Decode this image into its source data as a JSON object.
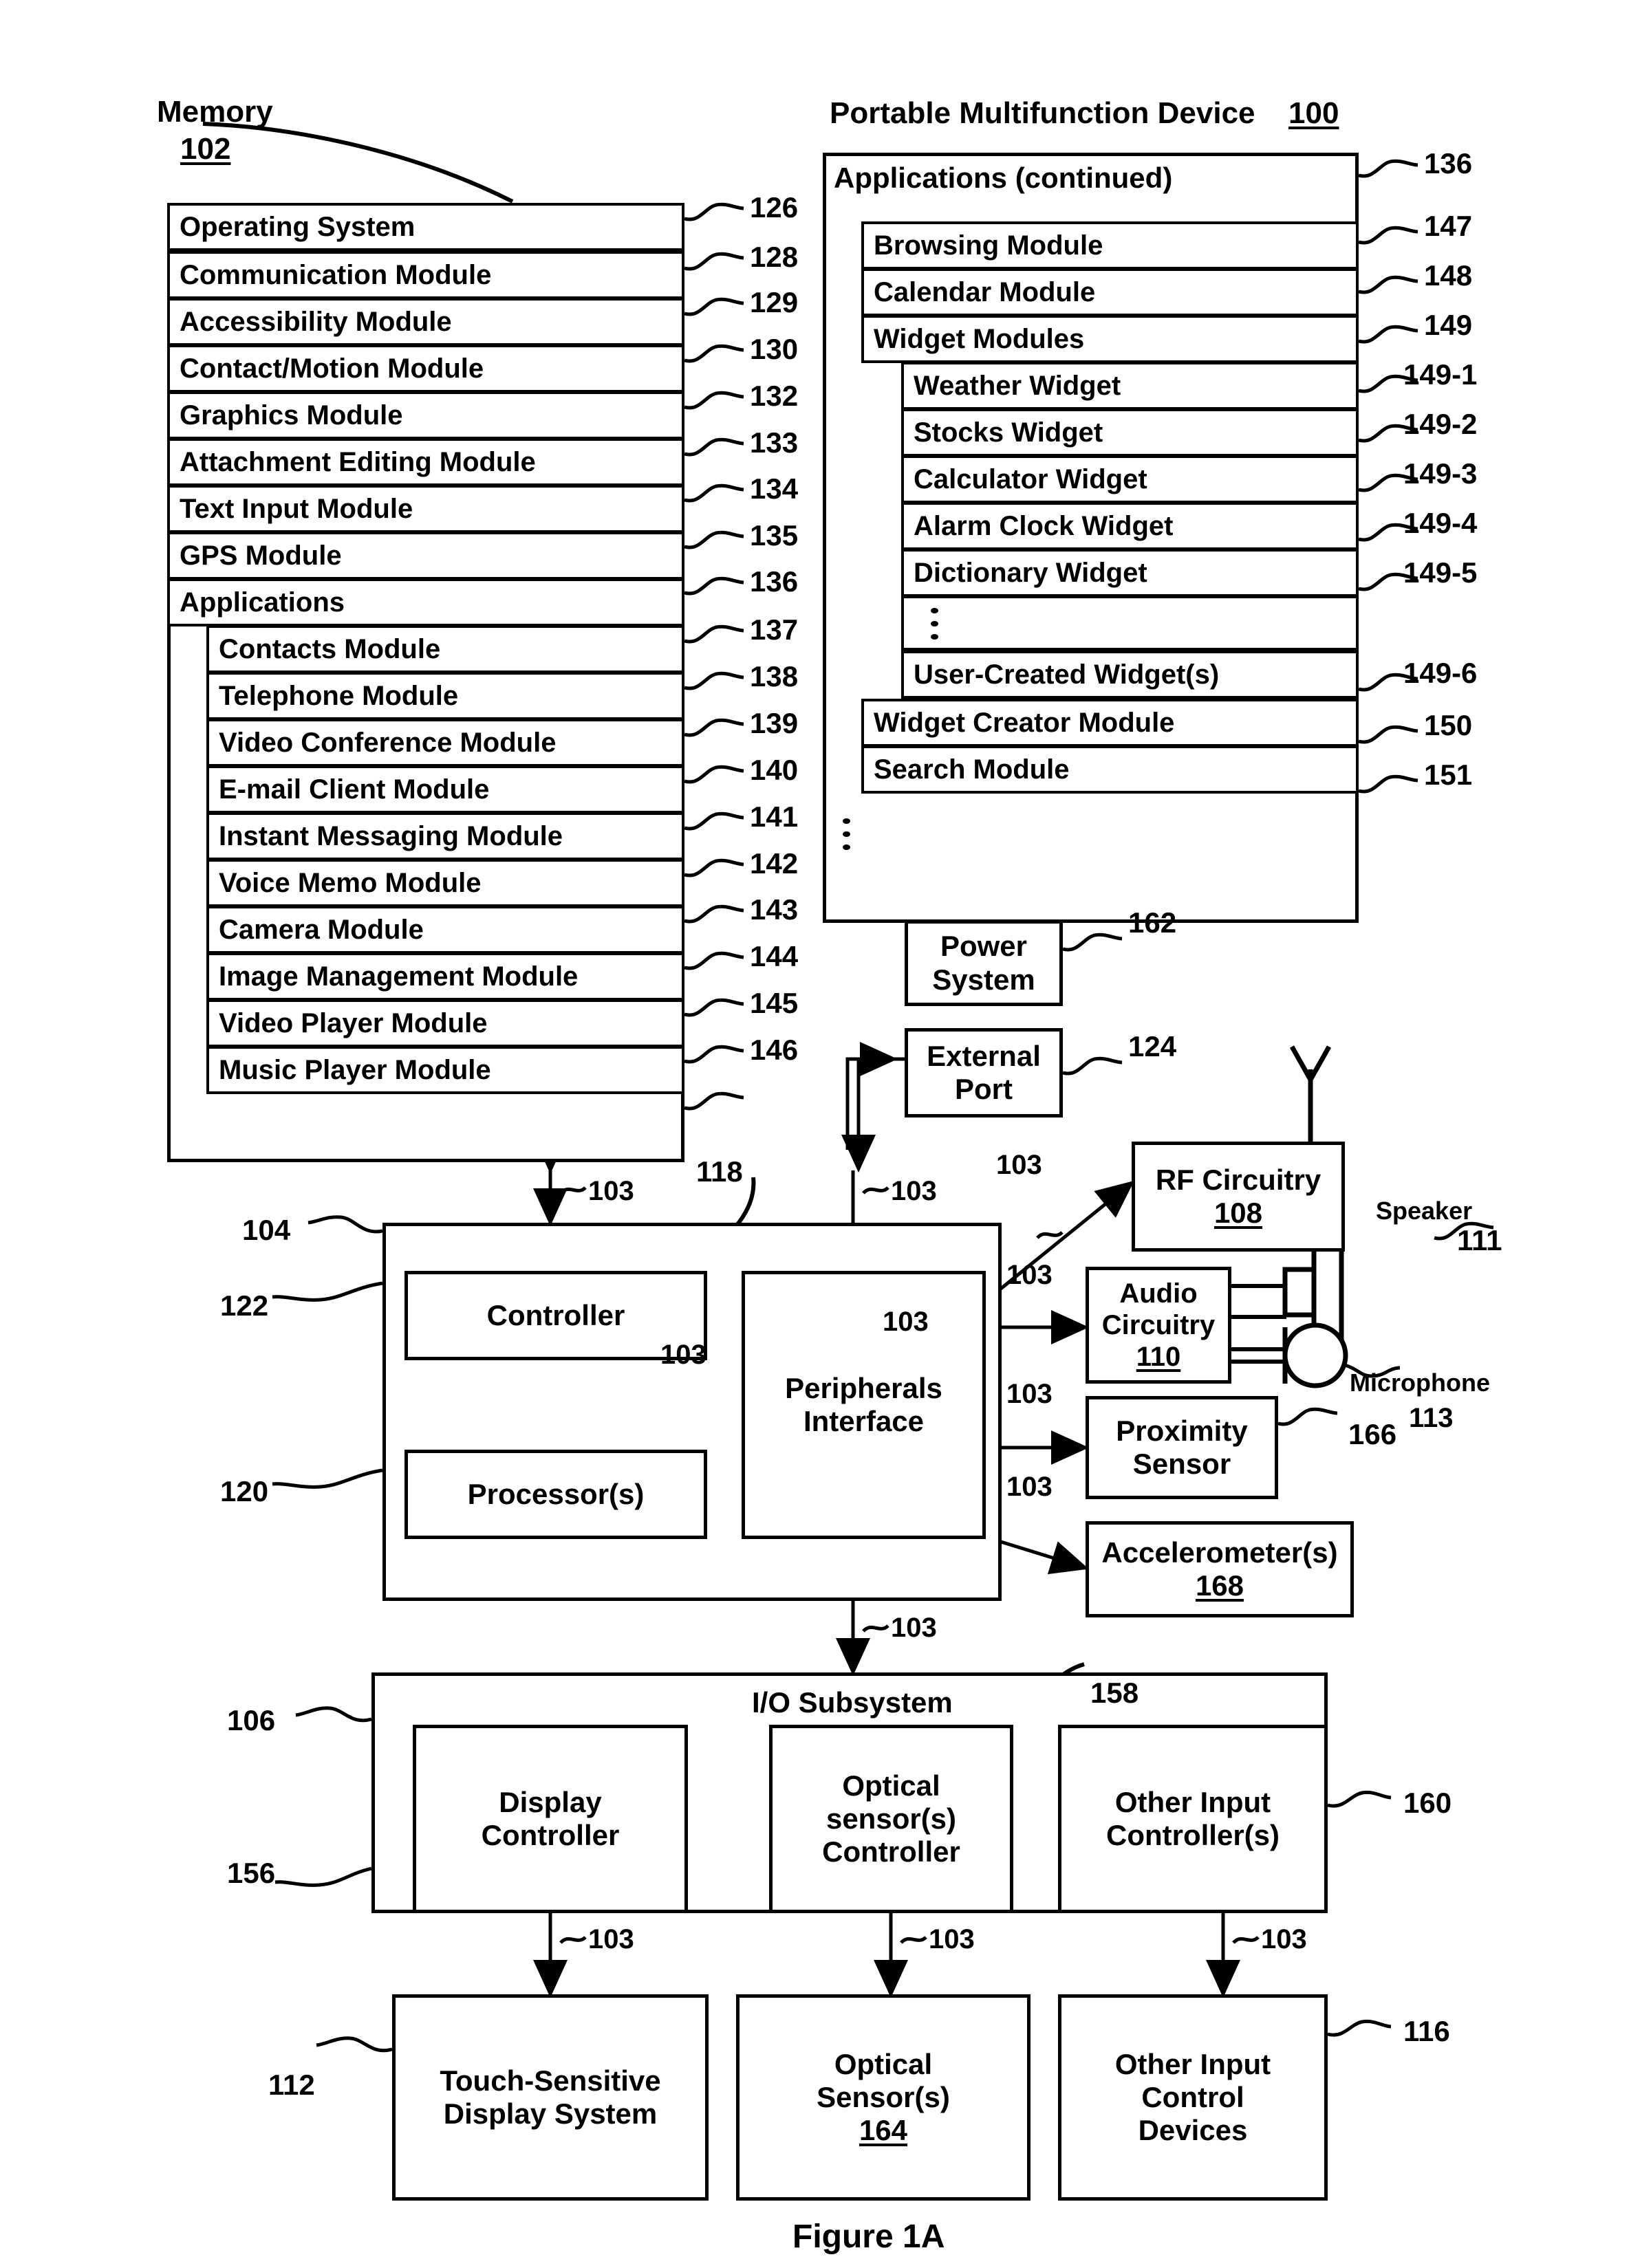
{
  "figure": {
    "caption": "Figure 1A"
  },
  "memory": {
    "title": "Memory",
    "ref": "102",
    "rows": [
      {
        "label": "Operating System",
        "ref": "126"
      },
      {
        "label": "Communication Module",
        "ref": "128"
      },
      {
        "label": "Accessibility Module",
        "ref": "129"
      },
      {
        "label": "Contact/Motion Module",
        "ref": "130"
      },
      {
        "label": "Graphics Module",
        "ref": "132"
      },
      {
        "label": "Attachment Editing Module",
        "ref": "133"
      },
      {
        "label": "Text Input Module",
        "ref": "134"
      },
      {
        "label": "GPS Module",
        "ref": "135"
      },
      {
        "label": "Applications",
        "ref": "136"
      }
    ],
    "applications": [
      {
        "label": "Contacts Module",
        "ref": "137"
      },
      {
        "label": "Telephone Module",
        "ref": "138"
      },
      {
        "label": "Video Conference Module",
        "ref": "139"
      },
      {
        "label": "E-mail Client Module",
        "ref": "140"
      },
      {
        "label": "Instant Messaging Module",
        "ref": "141"
      },
      {
        "label": "Voice Memo Module",
        "ref": "142"
      },
      {
        "label": "Camera Module",
        "ref": "143"
      },
      {
        "label": "Image Management Module",
        "ref": "144"
      },
      {
        "label": "Video Player Module",
        "ref": "145"
      },
      {
        "label": "Music Player Module",
        "ref": "146"
      }
    ]
  },
  "device": {
    "title": "Portable Multifunction Device",
    "ref": "100",
    "applications_continued": {
      "label": "Applications (continued)",
      "ref": "136",
      "rows": [
        {
          "label": "Browsing Module",
          "ref": "147"
        },
        {
          "label": "Calendar Module",
          "ref": "148"
        },
        {
          "label": "Widget Modules",
          "ref": "149"
        }
      ],
      "widgets": [
        {
          "label": "Weather Widget",
          "ref": "149-1"
        },
        {
          "label": "Stocks Widget",
          "ref": "149-2"
        },
        {
          "label": "Calculator Widget",
          "ref": "149-3"
        },
        {
          "label": "Alarm Clock Widget",
          "ref": "149-4"
        },
        {
          "label": "Dictionary Widget",
          "ref": "149-5"
        },
        {
          "label": "User-Created Widget(s)",
          "ref": "149-6"
        }
      ],
      "trailing_rows": [
        {
          "label": "Widget Creator Module",
          "ref": "150"
        },
        {
          "label": "Search Module",
          "ref": "151"
        }
      ]
    }
  },
  "blocks": {
    "power_system": {
      "line1": "Power",
      "line2": "System",
      "ref": "162"
    },
    "external_port": {
      "line1": "External",
      "line2": "Port",
      "ref": "124"
    },
    "rf_circuitry": {
      "line1": "RF Circuitry",
      "ref": "108"
    },
    "audio_circuitry": {
      "line1": "Audio",
      "line2": "Circuitry",
      "ref": "110"
    },
    "proximity_sensor": {
      "line1": "Proximity",
      "line2": "Sensor",
      "ref": "166"
    },
    "accelerometers": {
      "line1": "Accelerometer(s)",
      "ref": "168"
    },
    "speaker": {
      "label": "Speaker",
      "ref": "111"
    },
    "microphone": {
      "label": "Microphone",
      "ref": "113"
    },
    "cpu_group": {
      "ref": "104"
    },
    "controller": {
      "label": "Controller",
      "ref": "122"
    },
    "processors": {
      "label": "Processor(s)",
      "ref": "120"
    },
    "peripherals": {
      "line1": "Peripherals",
      "line2": "Interface",
      "ref": "118"
    },
    "io_subsystem": {
      "label": "I/O Subsystem",
      "ref": "158",
      "outer_ref": "106"
    },
    "display_controller": {
      "line1": "Display",
      "line2": "Controller",
      "ref": "156"
    },
    "optical_controller": {
      "line1": "Optical",
      "line2": "sensor(s)",
      "line3": "Controller"
    },
    "other_input_controller": {
      "line1": "Other Input",
      "line2": "Controller(s)",
      "ref": "160"
    },
    "touch_display": {
      "line1": "Touch-Sensitive",
      "line2": "Display System",
      "ref": "112"
    },
    "optical_sensors": {
      "line1": "Optical",
      "line2": "Sensor(s)",
      "ref": "164"
    },
    "other_input_devices": {
      "line1": "Other Input",
      "line2": "Control",
      "line3": "Devices",
      "ref": "116"
    }
  },
  "bus_label": "103"
}
